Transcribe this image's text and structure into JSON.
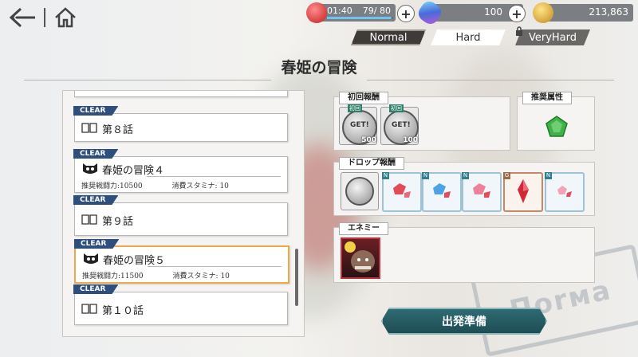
{
  "resources": {
    "time": "01:40",
    "stamina": "79/ 80",
    "stamina_fill": 0.9875,
    "gems": "100",
    "gold": "213,863",
    "plus_label": "+"
  },
  "tabs": [
    {
      "label": "Normal",
      "state": "active"
    },
    {
      "label": "Hard",
      "state": "inactive"
    },
    {
      "label": "VeryHard",
      "state": "locked"
    }
  ],
  "title": "春姫の冒険",
  "quest_list": {
    "items": [
      {
        "badge": "CLEAR",
        "title": "第８話",
        "type": "story"
      },
      {
        "badge": "CLEAR",
        "title": "春姫の冒険４",
        "type": "battle",
        "power": "推奨戦闘力:10500",
        "stamina": "消費スタミナ: 10"
      },
      {
        "badge": "CLEAR",
        "title": "第９話",
        "type": "story"
      },
      {
        "badge": "CLEAR",
        "title": "春姫の冒険５",
        "type": "battle",
        "power": "推奨戦闘力:11500",
        "stamina": "消費スタミナ: 10",
        "selected": true
      },
      {
        "badge": "CLEAR",
        "title": "第１０話",
        "type": "story"
      }
    ]
  },
  "first_reward": {
    "label": "初回報酬",
    "items": [
      {
        "tag": "初回",
        "name": "GET!",
        "count": "500"
      },
      {
        "tag": "初回",
        "name": "GET!",
        "count": "100"
      }
    ]
  },
  "attribute": {
    "label": "推奨属性",
    "color": "#3fb34a"
  },
  "drop_reward": {
    "label": "ドロップ報酬",
    "items": [
      {
        "rank": "",
        "icon": "coin-icon"
      },
      {
        "rank": "N",
        "icon": "red-gem-icon"
      },
      {
        "rank": "N",
        "icon": "blue-gem-icon"
      },
      {
        "rank": "N",
        "icon": "pink-gem-icon"
      },
      {
        "rank": "G",
        "icon": "crystal-icon"
      },
      {
        "rank": "N",
        "icon": "pink-gem-icon"
      }
    ]
  },
  "enemy": {
    "label": "エネミー",
    "icon": "enemy-portrait-icon"
  },
  "start_button": "出発準備",
  "colors": {
    "accent": "#2f6d75",
    "badge": "#2e4e7e",
    "selected": "#f0a94a"
  }
}
